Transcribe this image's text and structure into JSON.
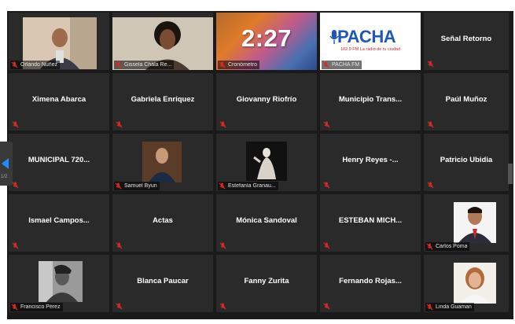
{
  "meeting": {
    "accent_color": "#1e8bff",
    "muted_icon": "mic-muted-icon",
    "tiles": [
      {
        "name": "",
        "label": "Orlando Nuñez",
        "muted": true,
        "video": "man-video"
      },
      {
        "name": "",
        "label": "Gissela Chala Re...",
        "muted": true,
        "video": "woman-video"
      },
      {
        "name": "",
        "label": "Cronómetro",
        "muted": true,
        "video": "timer"
      },
      {
        "name": "",
        "label": "PACHA FM",
        "muted": true,
        "video": "pacha-logo"
      },
      {
        "name": "Señal Retorno",
        "label": "",
        "muted": true,
        "video": ""
      },
      {
        "name": "Ximena Abarca",
        "label": "",
        "muted": true,
        "video": ""
      },
      {
        "name": "Gabriela Enríquez",
        "label": "",
        "muted": true,
        "video": ""
      },
      {
        "name": "Giovanny Riofrío",
        "label": "",
        "muted": true,
        "video": ""
      },
      {
        "name": "Municipio Trans...",
        "label": "",
        "muted": true,
        "video": ""
      },
      {
        "name": "Paúl Muñoz",
        "label": "",
        "muted": true,
        "video": ""
      },
      {
        "name": "MUNICIPAL 720...",
        "label": "",
        "muted": true,
        "video": ""
      },
      {
        "name": "",
        "label": "Samuel Byun",
        "muted": true,
        "video": "profile-photo"
      },
      {
        "name": "",
        "label": "Estefanía Granau...",
        "muted": true,
        "video": "statue-photo"
      },
      {
        "name": "Henry Reyes -...",
        "label": "",
        "muted": true,
        "video": ""
      },
      {
        "name": "Patricio Ubidia",
        "label": "",
        "muted": true,
        "video": ""
      },
      {
        "name": "Ismael Campos...",
        "label": "",
        "muted": true,
        "video": ""
      },
      {
        "name": "Actas",
        "label": "",
        "muted": true,
        "video": ""
      },
      {
        "name": "Mónica Sandoval",
        "label": "",
        "muted": true,
        "video": ""
      },
      {
        "name": "ESTEBAN MICH...",
        "label": "",
        "muted": true,
        "video": ""
      },
      {
        "name": "",
        "label": "Carlos Poma",
        "muted": true,
        "video": "profile-photo"
      },
      {
        "name": "",
        "label": "Francisco Pérez",
        "muted": true,
        "video": "bw-photo"
      },
      {
        "name": "Blanca Paucar",
        "label": "",
        "muted": true,
        "video": ""
      },
      {
        "name": "Fanny Zurita",
        "label": "",
        "muted": true,
        "video": ""
      },
      {
        "name": "Fernando Rojas...",
        "label": "",
        "muted": true,
        "video": ""
      },
      {
        "name": "",
        "label": "Linda Guaman",
        "muted": true,
        "video": "profile-photo"
      }
    ],
    "timer": {
      "value": "2:27"
    },
    "pacha": {
      "logo_text": "PACHA",
      "tagline": "102.9 FM  La radio de tu ciudad"
    },
    "pager": {
      "page_label": "1/2"
    }
  }
}
